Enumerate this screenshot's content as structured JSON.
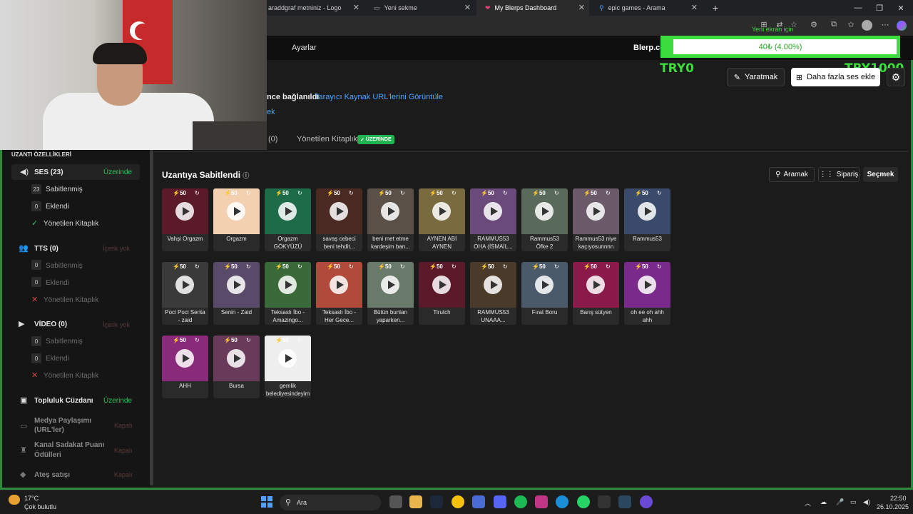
{
  "tabs": [
    {
      "label": "araddgraf metniniz - Logo"
    },
    {
      "label": "Yeni sekme"
    },
    {
      "label": "My Blerps Dashboard"
    },
    {
      "label": "epic games - Arama"
    }
  ],
  "toolbar": {
    "overlay_text": "Yeni ekran için"
  },
  "nav": {
    "settings": "Ayarlar",
    "partial_link": "i",
    "brand": "Blerp.co"
  },
  "goal": {
    "text": "40₺ (4.00%)",
    "progress": 0.04,
    "min_label": "TRY0",
    "max_label": "TRY1000"
  },
  "actions": {
    "create": "Yaratmak",
    "add_sounds": "Daha fazla ses ekle"
  },
  "connection": {
    "status": "nce bağlanıldı",
    "view_link": "Tarayıcı Kaynak URL'lerini Görüntüle",
    "second_link": "ek"
  },
  "lib_tabs": {
    "count": "(0)",
    "managed": "Yönetilen Kitaplık",
    "badge": "ÜZERİNDE"
  },
  "sidebar": {
    "header": "UZANTI ÖZELLİKLERİ",
    "sound": {
      "title": "SES (23)",
      "status": "Üzerinde",
      "pinned_count": "23",
      "pinned": "Sabitlenmiş",
      "added_count": "0",
      "added": "Eklendi",
      "managed": "Yönetilen Kitaplık"
    },
    "tts": {
      "title": "TTS (0)",
      "status": "İçerik yok",
      "pinned_count": "0",
      "pinned": "Sabitlenmiş",
      "added_count": "0",
      "added": "Eklendi",
      "managed": "Yönetilen Kitaplık"
    },
    "video": {
      "title": "VİDEO (0)",
      "status": "İçerik yok",
      "pinned_count": "0",
      "pinned": "Sabitlenmiş",
      "added_count": "0",
      "added": "Eklendi",
      "managed": "Yönetilen Kitaplık"
    },
    "wallet": {
      "title": "Topluluk Cüzdanı",
      "status": "Üzerinde"
    },
    "media": {
      "title_1": "Medya Paylaşımı",
      "title_2": "(URL'ler)",
      "status": "Kapalı"
    },
    "loyalty": {
      "title_1": "Kanal Sadakat Puanı",
      "title_2": "Ödülleri",
      "status": "Kapalı"
    },
    "fire": {
      "title": "Ateş satışı",
      "status": "Kapalı"
    }
  },
  "main": {
    "title": "Uzantıya Sabitlendi",
    "search": "Aramak",
    "order": "Sipariş",
    "select": "Seçmek",
    "price": "50",
    "cards": [
      {
        "l1": "Vahşi Orgazm",
        "l2": "",
        "color": "#5a1a2a"
      },
      {
        "l1": "Orgazm",
        "l2": "",
        "color": "#f2d0b0"
      },
      {
        "l1": "Orgazm",
        "l2": "GÖKYÜZÜ",
        "color": "#1e6b4a"
      },
      {
        "l1": "savaş cebeci",
        "l2": "beni tehdit...",
        "color": "#4a2a22"
      },
      {
        "l1": "beni met etme",
        "l2": "kardeşim ban...",
        "color": "#5a5048"
      },
      {
        "l1": "AYNEN ABİ",
        "l2": "AYNEN",
        "color": "#7a6a40"
      },
      {
        "l1": "RAMMUS53",
        "l2": "OHA (İSMAİL...",
        "color": "#6a4a7a"
      },
      {
        "l1": "Rammus53",
        "l2": "Öfke 2",
        "color": "#5a6a5a"
      },
      {
        "l1": "Rammus53 niye",
        "l2": "kaçıyosunnnn",
        "color": "#6a5a6a"
      },
      {
        "l1": "Rammus53",
        "l2": "",
        "color": "#3a4a6a"
      },
      {
        "l1": "Poci Poci Senta",
        "l2": "- zaid",
        "color": "#3a3a3a"
      },
      {
        "l1": "Senin - Zaid",
        "l2": "",
        "color": "#5a4a6a"
      },
      {
        "l1": "Teksaslı İbo -",
        "l2": "Amazingo...",
        "color": "#3a6a3a"
      },
      {
        "l1": "Teksaslı İbo -",
        "l2": "Her Gece...",
        "color": "#b04a3a"
      },
      {
        "l1": "Bütün bunları",
        "l2": "yaparken...",
        "color": "#6a7a6a"
      },
      {
        "l1": "Tirutch",
        "l2": "",
        "color": "#5a1a2a"
      },
      {
        "l1": "RAMMUS53",
        "l2": "UNAAA...",
        "color": "#4a3a2a"
      },
      {
        "l1": "Fırat Boru",
        "l2": "",
        "color": "#4a5a6a"
      },
      {
        "l1": "Barış sütyen",
        "l2": "",
        "color": "#8a1a4a"
      },
      {
        "l1": "oh ee oh ahh",
        "l2": "ahh",
        "color": "#7a2a8a"
      },
      {
        "l1": "AHH",
        "l2": "",
        "color": "#8a2a7a"
      },
      {
        "l1": "Bursa",
        "l2": "",
        "color": "#6a3a5a"
      },
      {
        "l1": "gemlik",
        "l2": "belediyesindeyim",
        "color": "#eeeeee"
      }
    ]
  },
  "taskbar": {
    "search": "Ara",
    "weather_temp": "17°C",
    "weather_desc": "Çok bulutlu",
    "time": "22:50",
    "date": "26.10.2025"
  },
  "colors": {
    "accent_green": "#3ddc3d",
    "on_green": "#2ec45a",
    "link_blue": "#4fa3ff"
  }
}
